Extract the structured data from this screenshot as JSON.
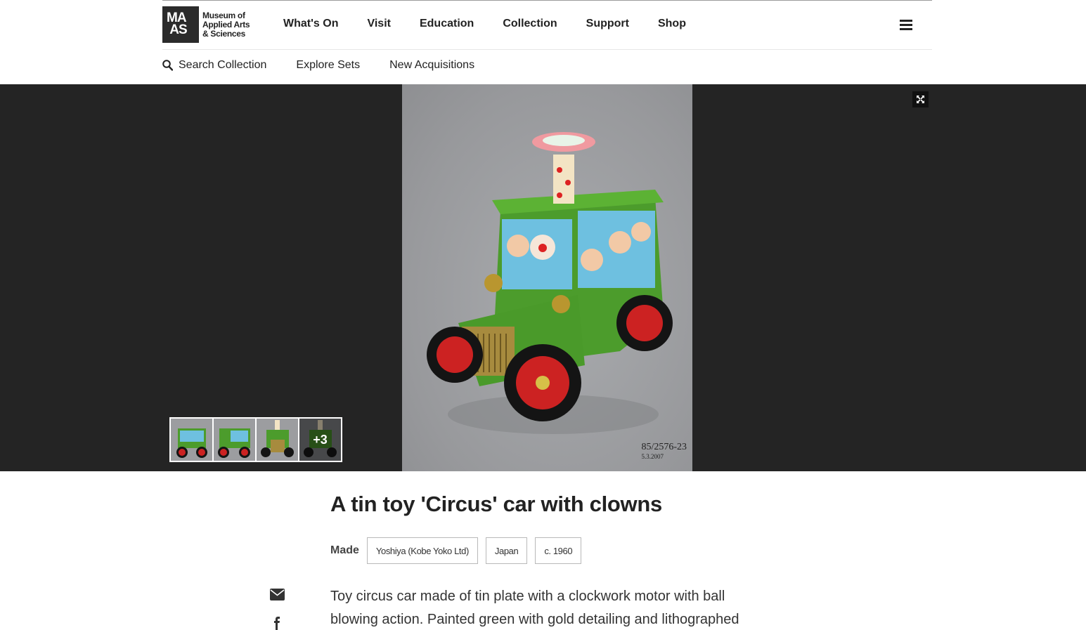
{
  "header": {
    "logo": {
      "mark": "MA AS",
      "text_line1": "Museum of",
      "text_line2": "Applied Arts",
      "text_line3": "& Sciences"
    },
    "nav": [
      "What's On",
      "Visit",
      "Education",
      "Collection",
      "Support",
      "Shop"
    ]
  },
  "subnav": {
    "search_label": "Search Collection",
    "explore_label": "Explore Sets",
    "acquisitions_label": "New Acquisitions"
  },
  "gallery": {
    "photo_label": "85/2576-23",
    "photo_date": "5.3.2007",
    "more_count": "+3"
  },
  "object": {
    "title": "A tin toy 'Circus' car with clowns",
    "made_label": "Made",
    "made_tags": [
      "Yoshiya (Kobe Yoko Ltd)",
      "Japan",
      "c. 1960"
    ],
    "description": "Toy circus car made of tin plate with a clockwork motor with ball blowing action. Painted green with gold detailing and lithographed"
  },
  "colors": {
    "gallery_bg": "#242424",
    "toy_green": "#4a9a2a",
    "accent_dark": "#222222"
  }
}
